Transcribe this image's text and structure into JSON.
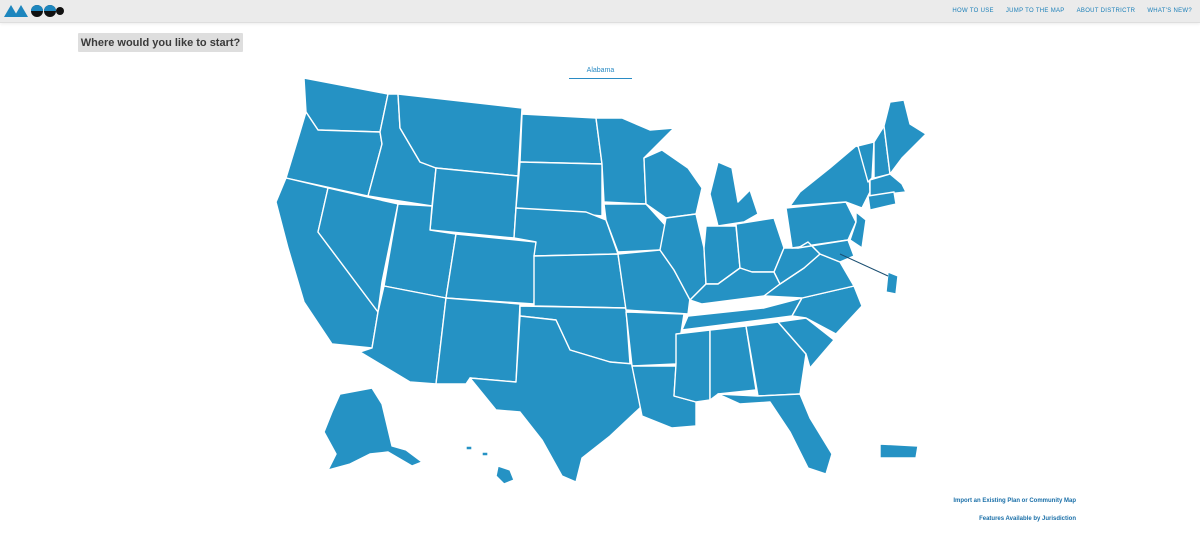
{
  "header": {
    "logo_icon": "districtr-logo-icon",
    "nav": [
      {
        "label": "HOW TO USE"
      },
      {
        "label": "JUMP TO THE MAP"
      },
      {
        "label": "ABOUT DISTRICTR"
      },
      {
        "label": "WHAT'S NEW?"
      }
    ]
  },
  "main": {
    "prompt": "Where would you like to start?",
    "hovered_state": "Alabama"
  },
  "footer": {
    "import_link": "Import an Existing Plan or Community Map",
    "features_link": "Features Available by Jurisdiction"
  },
  "colors": {
    "accent": "#2592c4",
    "topbar": "#ebebeb",
    "prompt_bg": "#dedede"
  }
}
